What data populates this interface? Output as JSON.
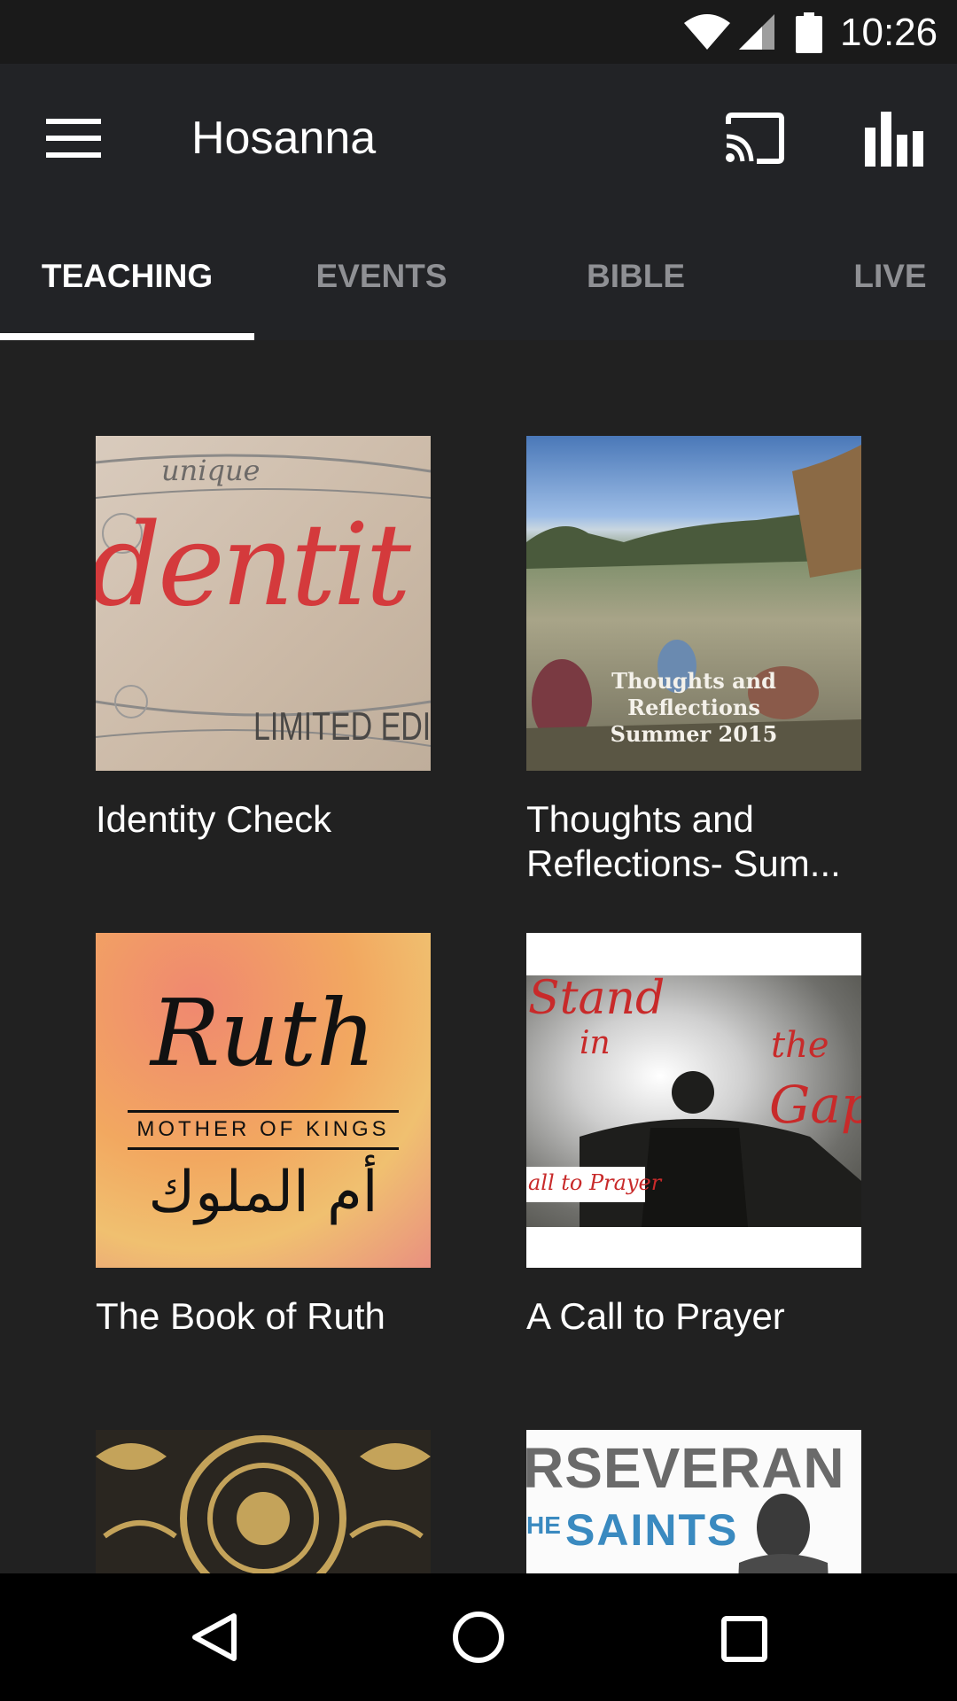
{
  "status_bar": {
    "time": "10:26",
    "icons": [
      "wifi-icon",
      "signal-icon",
      "battery-icon"
    ]
  },
  "app_bar": {
    "title": "Hosanna",
    "icons": [
      "menu-icon",
      "cast-icon",
      "stats-icon"
    ]
  },
  "tabs": [
    {
      "label": "TEACHING",
      "active": true
    },
    {
      "label": "EVENTS",
      "active": false
    },
    {
      "label": "BIBLE",
      "active": false
    },
    {
      "label": "LIVE",
      "active": false
    }
  ],
  "teachings": [
    {
      "title": "Identity Check",
      "image_text": {
        "small": "unique",
        "large": "dentit",
        "edition": "LIMITED EDITION"
      }
    },
    {
      "title": "Thoughts and Reflections- Sum...",
      "image_text": {
        "line1": "Thoughts and",
        "line2": "Reflections",
        "line3": "Summer 2015"
      }
    },
    {
      "title": "The Book of Ruth",
      "image_text": {
        "main": "Ruth",
        "sub": "MOTHER OF KINGS",
        "arabic": "أم الملوك"
      }
    },
    {
      "title": "A Call to Prayer",
      "image_text": {
        "top": "Stand",
        "in": "in",
        "the": "the",
        "gap": "Gap",
        "banner": "all to Prayer"
      }
    },
    {
      "title": "",
      "image_text": {}
    },
    {
      "title": "",
      "image_text": {
        "top": "RSEVERAN",
        "pre": "HE",
        "main": "SAINTS"
      }
    }
  ],
  "nav_bar": {
    "icons": [
      "back-icon",
      "home-icon",
      "recents-icon"
    ]
  },
  "colors": {
    "background": "#212121",
    "app_bar": "#222326",
    "tab_inactive": "#8f9094",
    "accent": "#ffffff"
  }
}
